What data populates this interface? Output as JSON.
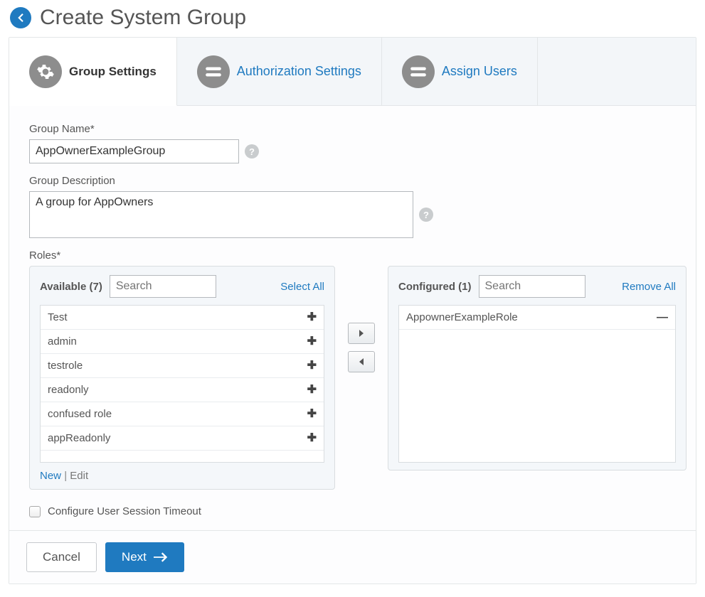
{
  "header": {
    "title": "Create System Group"
  },
  "tabs": [
    {
      "label": "Group Settings",
      "icon": "gear-icon",
      "active": true
    },
    {
      "label": "Authorization Settings",
      "icon": "stack-icon",
      "active": false
    },
    {
      "label": "Assign Users",
      "icon": "stack-icon",
      "active": false
    }
  ],
  "form": {
    "group_name_label": "Group Name*",
    "group_name_value": "AppOwnerExampleGroup",
    "group_desc_label": "Group Description",
    "group_desc_value": "A group for AppOwners",
    "roles_label": "Roles*"
  },
  "available_panel": {
    "title": "Available (7)",
    "search_placeholder": "Search",
    "select_all": "Select All",
    "items": [
      "Test",
      "admin",
      "testrole",
      "readonly",
      "confused role",
      "appReadonly"
    ],
    "footer_new": "New",
    "footer_edit": "Edit"
  },
  "configured_panel": {
    "title": "Configured (1)",
    "search_placeholder": "Search",
    "remove_all": "Remove All",
    "items": [
      "AppownerExampleRole"
    ]
  },
  "session_timeout_label": "Configure User Session Timeout",
  "footer": {
    "cancel": "Cancel",
    "next": "Next"
  }
}
